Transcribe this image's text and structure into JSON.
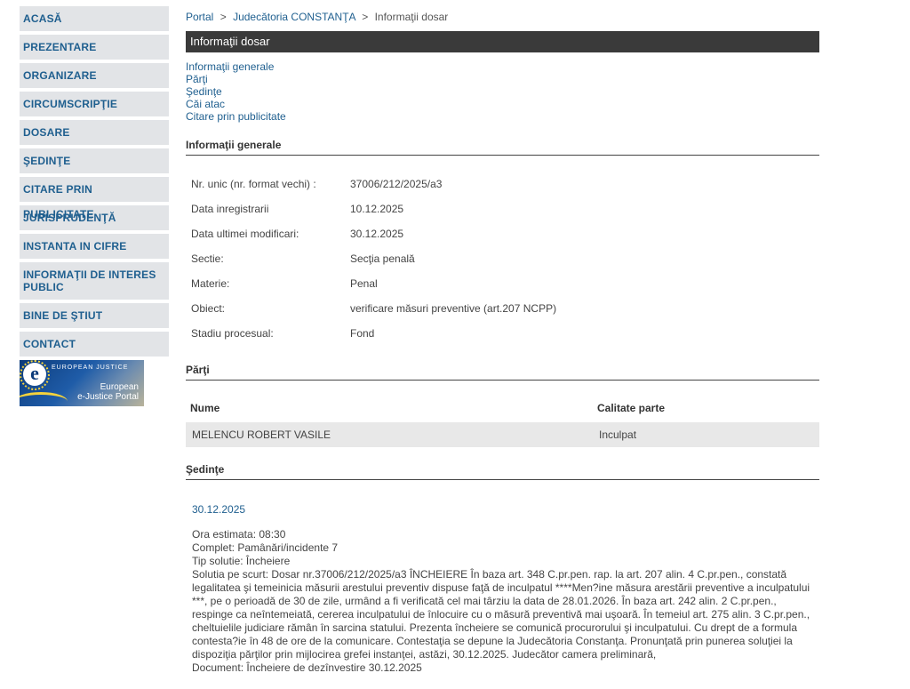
{
  "sidebar": {
    "items": [
      {
        "label": "ACASĂ"
      },
      {
        "label": "PREZENTARE"
      },
      {
        "label": "ORGANIZARE"
      },
      {
        "label": "CIRCUMSCRIPŢIE"
      },
      {
        "label": "DOSARE"
      },
      {
        "label": "ŞEDINŢE"
      },
      {
        "label": "CITARE PRIN PUBLICITATE"
      },
      {
        "label": "JURISPRUDENŢĂ"
      },
      {
        "label": "INSTANTA IN CIFRE"
      },
      {
        "label": "INFORMAŢII DE INTERES PUBLIC"
      },
      {
        "label": "BINE DE ŞTIUT"
      },
      {
        "label": "CONTACT"
      }
    ],
    "banner": {
      "small_text": "EUROPEAN JUSTICE",
      "caption_line1": "European",
      "caption_line2": "e-Justice Portal",
      "logo_letter": "e"
    }
  },
  "breadcrumb": {
    "portal": "Portal",
    "court": "Judecătoria CONSTANŢA",
    "current": "Informaţii dosar",
    "sep": ">"
  },
  "page": {
    "title": "Informaţii dosar",
    "anchors": [
      "Informaţii generale",
      "Părţi",
      "Şedinţe",
      "Căi atac",
      "Citare prin publicitate"
    ]
  },
  "general": {
    "heading": "Informaţii generale",
    "rows": [
      {
        "key": "Nr. unic (nr. format vechi) :",
        "value": "37006/212/2025/a3"
      },
      {
        "key": "Data inregistrarii",
        "value": "10.12.2025"
      },
      {
        "key": "Data ultimei modificari:",
        "value": "30.12.2025"
      },
      {
        "key": "Sectie:",
        "value": "Secţia penală"
      },
      {
        "key": "Materie:",
        "value": "Penal"
      },
      {
        "key": "Obiect:",
        "value": "verificare măsuri preventive (art.207 NCPP)"
      },
      {
        "key": "Stadiu procesual:",
        "value": "Fond"
      }
    ]
  },
  "parties": {
    "heading": "Părţi",
    "col_name": "Nume",
    "col_role": "Calitate parte",
    "rows": [
      {
        "name": "MELENCU ROBERT VASILE",
        "role": "Inculpat"
      }
    ]
  },
  "sessions": {
    "heading": "Şedinţe",
    "date": "30.12.2025",
    "ora": "Ora estimata: 08:30",
    "complet": "Complet: Pamânări/incidente 7",
    "tip": "Tip solutie: Încheiere",
    "solutie": "Solutia pe scurt: Dosar nr.37006/212/2025/a3 ÎNCHEIERE În baza art. 348 C.pr.pen. rap. la art. 207 alin. 4 C.pr.pen., constată legalitatea şi temeinicia măsurii arestului preventiv dispuse faţă de inculpatul ****Men?ine măsura arestării preventive a inculpatului ***, pe o perioadă de 30 de zile, urmând a fi verificată cel mai târziu la data de 28.01.2026. În baza art. 242 alin. 2 C.pr.pen., respinge ca neîntemeiată, cererea inculpatului de înlocuire cu o măsură preventivă mai uşoară. În temeiul art. 275 alin. 3 C.pr.pen., cheltuielile judiciare rămân în sarcina statului. Prezenta încheiere se comunică procurorului şi inculpatului. Cu drept de a formula contesta?ie în 48 de ore de la comunicare. Contestaţia se depune la Judecătoria Constanţa. Pronunţată prin punerea soluţiei la dispoziţia părţilor prin mijlocirea grefei instanţei, astăzi, 30.12.2025. Judecător camera preliminară,",
    "document": "Document: Încheiere de dezînvestire    30.12.2025"
  }
}
